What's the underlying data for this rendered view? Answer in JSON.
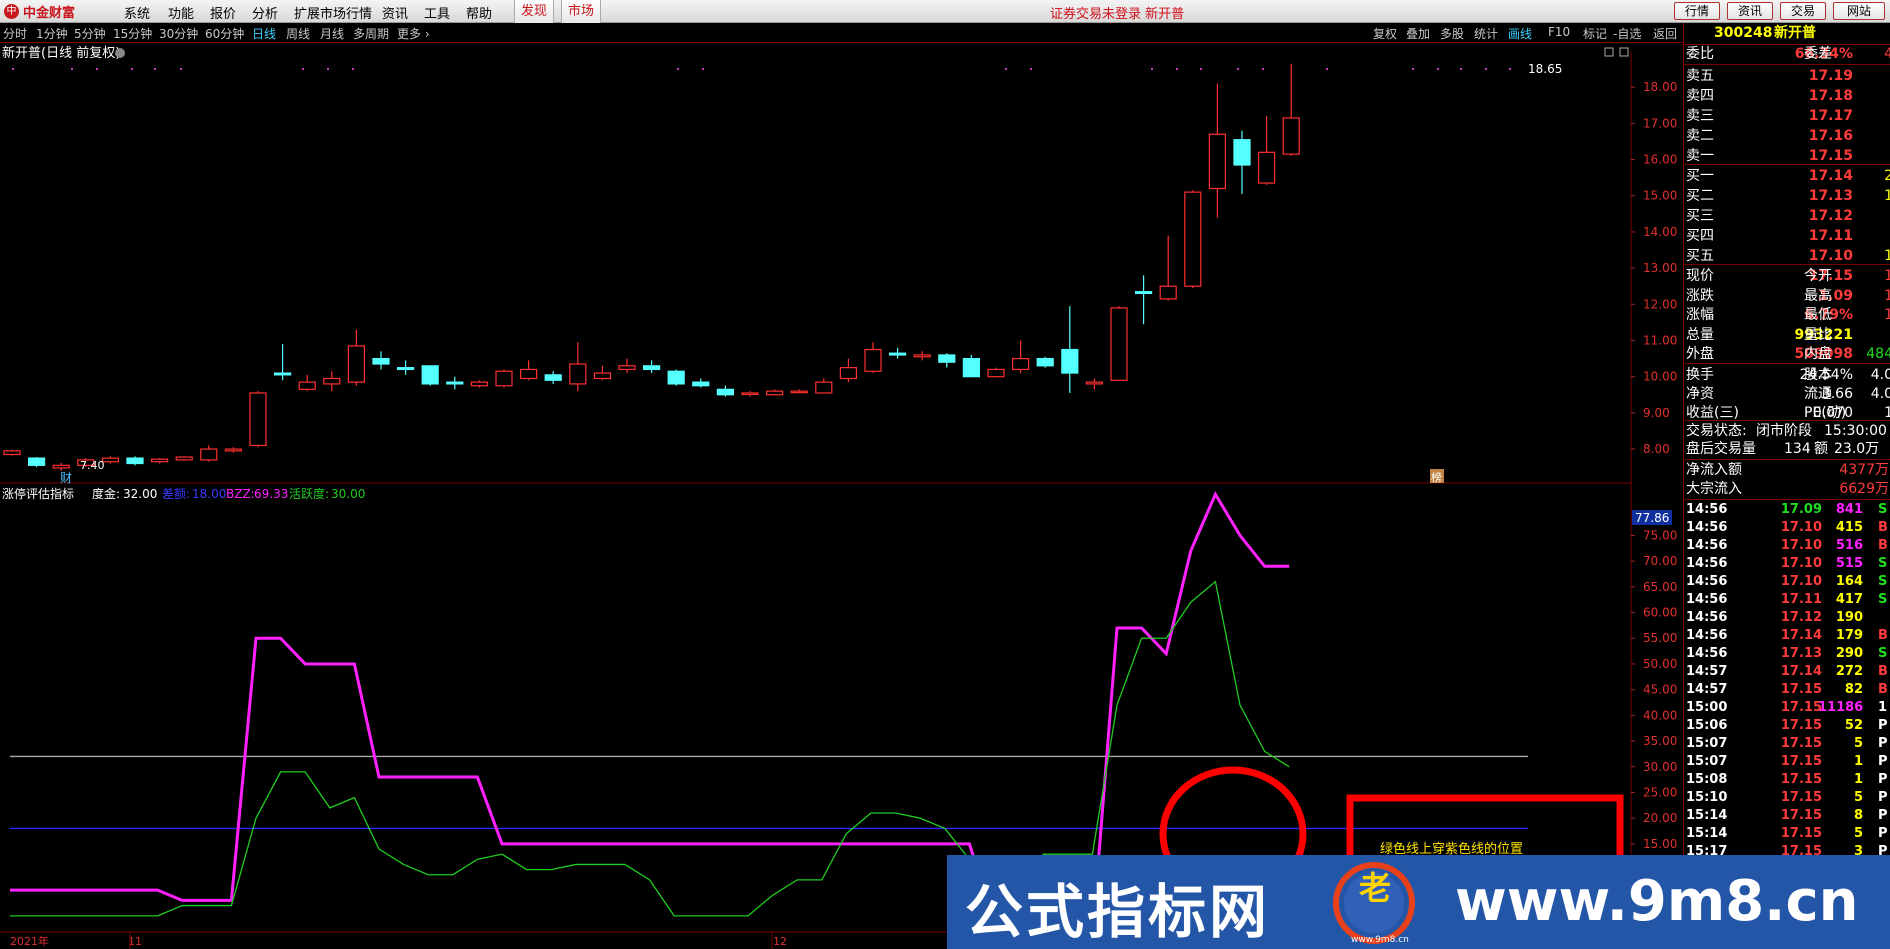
{
  "app": {
    "brand": "中金财富",
    "brand_mark": "中"
  },
  "menubar": {
    "items": [
      "系统",
      "功能",
      "报价",
      "分析",
      "扩展市场行情",
      "资讯",
      "工具",
      "帮助"
    ],
    "highlight": [
      "发现",
      "市场"
    ],
    "notice": "证券交易未登录  新开普",
    "right_buttons": [
      "行情",
      "资讯",
      "交易",
      "网站"
    ]
  },
  "periods": [
    "分时",
    "1分钟",
    "5分钟",
    "15分钟",
    "30分钟",
    "60分钟",
    "日线",
    "周线",
    "月线",
    "多周期",
    "更多 ›"
  ],
  "active_period": "日线",
  "toolbar_right": [
    "复权",
    "叠加",
    "多股",
    "统计",
    "画线",
    "F10",
    "标记",
    "-自选",
    "返回"
  ],
  "active_tool": "画线",
  "main_chart": {
    "title": "新开普(日线 前复权)",
    "high_label": "18.65",
    "low_label": "7.40",
    "fin_marker": "财",
    "event_marker": "榜",
    "y_ticks": [
      "18.00",
      "17.00",
      "16.00",
      "15.00",
      "14.00",
      "13.00",
      "12.00",
      "11.00",
      "10.00",
      "9.00",
      "8.00"
    ]
  },
  "chart_data": [
    {
      "type": "candlestick",
      "title": "新开普(日线 前复权)",
      "ylim": [
        7.2,
        19.0
      ],
      "candles": [
        {
          "o": 7.85,
          "c": 7.95,
          "h": 7.98,
          "l": 7.82
        },
        {
          "o": 7.75,
          "c": 7.55,
          "h": 7.78,
          "l": 7.5
        },
        {
          "o": 7.48,
          "c": 7.55,
          "h": 7.62,
          "l": 7.4
        },
        {
          "o": 7.55,
          "c": 7.7,
          "h": 7.75,
          "l": 7.5
        },
        {
          "o": 7.65,
          "c": 7.75,
          "h": 7.8,
          "l": 7.6
        },
        {
          "o": 7.75,
          "c": 7.6,
          "h": 7.8,
          "l": 7.55
        },
        {
          "o": 7.65,
          "c": 7.72,
          "h": 7.75,
          "l": 7.6
        },
        {
          "o": 7.7,
          "c": 7.78,
          "h": 7.8,
          "l": 7.68
        },
        {
          "o": 7.7,
          "c": 8.0,
          "h": 8.1,
          "l": 7.65
        },
        {
          "o": 7.95,
          "c": 8.0,
          "h": 8.05,
          "l": 7.9
        },
        {
          "o": 8.1,
          "c": 9.55,
          "h": 9.6,
          "l": 8.05
        },
        {
          "o": 10.1,
          "c": 10.05,
          "h": 10.9,
          "l": 9.9
        },
        {
          "o": 9.65,
          "c": 9.85,
          "h": 10.05,
          "l": 9.6
        },
        {
          "o": 9.8,
          "c": 9.95,
          "h": 10.15,
          "l": 9.6
        },
        {
          "o": 9.85,
          "c": 10.85,
          "h": 11.3,
          "l": 9.75
        },
        {
          "o": 10.5,
          "c": 10.35,
          "h": 10.7,
          "l": 10.2
        },
        {
          "o": 10.25,
          "c": 10.2,
          "h": 10.45,
          "l": 10.05
        },
        {
          "o": 10.3,
          "c": 9.8,
          "h": 10.3,
          "l": 9.75
        },
        {
          "o": 9.85,
          "c": 9.8,
          "h": 10.0,
          "l": 9.65
        },
        {
          "o": 9.75,
          "c": 9.85,
          "h": 9.9,
          "l": 9.7
        },
        {
          "o": 9.75,
          "c": 10.15,
          "h": 10.2,
          "l": 9.7
        },
        {
          "o": 9.95,
          "c": 10.2,
          "h": 10.45,
          "l": 9.9
        },
        {
          "o": 10.05,
          "c": 9.9,
          "h": 10.15,
          "l": 9.8
        },
        {
          "o": 9.8,
          "c": 10.35,
          "h": 10.95,
          "l": 9.6
        },
        {
          "o": 9.95,
          "c": 10.1,
          "h": 10.3,
          "l": 9.9
        },
        {
          "o": 10.2,
          "c": 10.3,
          "h": 10.5,
          "l": 10.1
        },
        {
          "o": 10.3,
          "c": 10.2,
          "h": 10.45,
          "l": 10.1
        },
        {
          "o": 10.15,
          "c": 9.8,
          "h": 10.2,
          "l": 9.75
        },
        {
          "o": 9.85,
          "c": 9.75,
          "h": 9.95,
          "l": 9.7
        },
        {
          "o": 9.65,
          "c": 9.5,
          "h": 9.75,
          "l": 9.45
        },
        {
          "o": 9.55,
          "c": 9.55,
          "h": 9.6,
          "l": 9.45
        },
        {
          "o": 9.5,
          "c": 9.6,
          "h": 9.65,
          "l": 9.5
        },
        {
          "o": 9.6,
          "c": 9.6,
          "h": 9.65,
          "l": 9.55
        },
        {
          "o": 9.55,
          "c": 9.85,
          "h": 9.95,
          "l": 9.55
        },
        {
          "o": 9.95,
          "c": 10.25,
          "h": 10.5,
          "l": 9.85
        },
        {
          "o": 10.15,
          "c": 10.75,
          "h": 10.95,
          "l": 10.1
        },
        {
          "o": 10.65,
          "c": 10.6,
          "h": 10.8,
          "l": 10.5
        },
        {
          "o": 10.55,
          "c": 10.6,
          "h": 10.7,
          "l": 10.45
        },
        {
          "o": 10.6,
          "c": 10.4,
          "h": 10.65,
          "l": 10.25
        },
        {
          "o": 10.5,
          "c": 10.0,
          "h": 10.6,
          "l": 10.0
        },
        {
          "o": 10.0,
          "c": 10.2,
          "h": 10.25,
          "l": 10.0
        },
        {
          "o": 10.2,
          "c": 10.5,
          "h": 11.0,
          "l": 10.1
        },
        {
          "o": 10.5,
          "c": 10.3,
          "h": 10.55,
          "l": 10.25
        },
        {
          "o": 10.75,
          "c": 10.1,
          "h": 11.95,
          "l": 9.55
        },
        {
          "o": 9.8,
          "c": 9.85,
          "h": 9.95,
          "l": 9.65
        },
        {
          "o": 9.9,
          "c": 11.9,
          "h": 11.95,
          "l": 9.9
        },
        {
          "o": 12.35,
          "c": 12.3,
          "h": 12.8,
          "l": 11.45
        },
        {
          "o": 12.15,
          "c": 12.5,
          "h": 13.9,
          "l": 12.1
        },
        {
          "o": 12.5,
          "c": 15.1,
          "h": 15.15,
          "l": 12.45
        },
        {
          "o": 15.2,
          "c": 16.7,
          "h": 18.1,
          "l": 14.4
        },
        {
          "o": 16.55,
          "c": 15.85,
          "h": 16.8,
          "l": 15.05
        },
        {
          "o": 15.35,
          "c": 16.2,
          "h": 17.2,
          "l": 15.3
        },
        {
          "o": 16.15,
          "c": 17.15,
          "h": 18.65,
          "l": 16.1
        }
      ]
    },
    {
      "type": "line",
      "title": "涨停评估指标",
      "ylim": [
        0,
        85
      ],
      "series": [
        {
          "name": "BZZ",
          "color": "#ff22ff",
          "values": [
            6,
            6,
            6,
            6,
            6,
            6,
            6,
            4,
            4,
            4,
            55,
            55,
            50,
            50,
            50,
            28,
            28,
            28,
            28,
            28,
            15,
            15,
            15,
            15,
            15,
            15,
            15,
            15,
            15,
            15,
            15,
            15,
            15,
            15,
            15,
            15,
            15,
            15,
            15,
            15,
            0,
            -3,
            -3,
            -3,
            -3,
            57,
            57,
            52,
            72,
            83,
            75,
            69,
            69
          ]
        },
        {
          "name": "活跃度",
          "color": "#22cc22",
          "values": [
            1,
            1,
            1,
            1,
            1,
            1,
            1,
            3,
            3,
            3,
            20,
            29,
            29,
            22,
            24,
            14,
            11,
            9,
            9,
            12,
            13,
            10,
            10,
            11,
            11,
            11,
            8,
            1,
            1,
            1,
            1,
            5,
            8,
            8,
            17,
            21,
            21,
            20,
            18,
            12,
            2,
            2,
            13,
            13,
            13,
            42,
            55,
            55,
            62,
            66,
            42,
            33,
            30
          ]
        }
      ],
      "hlines": [
        {
          "value": 32.0,
          "color": "#aaaaaa"
        },
        {
          "value": 18.0,
          "color": "#2a2aff"
        }
      ],
      "y_ticks": [
        "75.00",
        "70.00",
        "65.00",
        "60.00",
        "55.00",
        "50.00",
        "45.00",
        "40.00",
        "35.00",
        "30.00",
        "25.00",
        "20.00",
        "15.00"
      ]
    }
  ],
  "indicator": {
    "name": "涨停评估指标",
    "dujin_label": "度金:",
    "dujin_value": "32.00",
    "bl_label": "差额:",
    "bl_value": "18.00",
    "bzz_label": "BZZ:",
    "bzz_value": "69.33",
    "act_label": "活跃度:",
    "act_value": "30.00",
    "cursor_value": "77.86"
  },
  "x_axis": {
    "labels": [
      "2021年",
      "11",
      "12"
    ]
  },
  "annotation": "绿色线上穿紫色线的位置",
  "watermark": {
    "left": "公式指标网",
    "right": "www.9m8.cn",
    "emblem": "老",
    "emblem_sub": "www.9m8.cn"
  },
  "panel": {
    "code": "300248",
    "name": "新开普",
    "weibi_label": "委比",
    "weibi_value": "66.34%",
    "weicha_label": "委差",
    "weicha_value": "4",
    "asks": [
      {
        "label": "卖五",
        "price": "17.19",
        "vol": ""
      },
      {
        "label": "卖四",
        "price": "17.18",
        "vol": ""
      },
      {
        "label": "卖三",
        "price": "17.17",
        "vol": ""
      },
      {
        "label": "卖二",
        "price": "17.16",
        "vol": ""
      },
      {
        "label": "卖一",
        "price": "17.15",
        "vol": ""
      }
    ],
    "bids": [
      {
        "label": "买一",
        "price": "17.14",
        "vol": "2"
      },
      {
        "label": "买二",
        "price": "17.13",
        "vol": "1"
      },
      {
        "label": "买三",
        "price": "17.12",
        "vol": ""
      },
      {
        "label": "买四",
        "price": "17.11",
        "vol": ""
      },
      {
        "label": "买五",
        "price": "17.10",
        "vol": "1"
      }
    ],
    "stats": [
      {
        "l1": "现价",
        "v1": "17.15",
        "c1": "red",
        "l2": "今开",
        "v2": "1",
        "c2": "red"
      },
      {
        "l1": "涨跌",
        "v1": "1.09",
        "c1": "red",
        "l2": "最高",
        "v2": "1",
        "c2": "red"
      },
      {
        "l1": "涨幅",
        "v1": "6.79%",
        "c1": "red",
        "l2": "最低",
        "v2": "1",
        "c2": "red"
      },
      {
        "l1": "总量",
        "v1": "993221",
        "c1": "yellow",
        "l2": "量比",
        "v2": "",
        "c2": "white"
      },
      {
        "l1": "外盘",
        "v1": "509098",
        "c1": "red",
        "l2": "内盘",
        "v2": "484",
        "c2": "green"
      }
    ],
    "stats2": [
      {
        "l1": "换手",
        "v1": "24.54%",
        "c1": "white",
        "l2": "股本",
        "v2": "4.0",
        "c2": "white"
      },
      {
        "l1": "净资",
        "v1": "3.66",
        "c1": "white",
        "l2": "流通",
        "v2": "4.0",
        "c2": "white"
      },
      {
        "l1": "收益(三)",
        "v1": "0.070",
        "c1": "white",
        "l2": "PE(动)",
        "v2": "1",
        "c2": "white"
      }
    ],
    "status_label": "交易状态:",
    "status_value": "闭市阶段",
    "status_time": "15:30:00",
    "after_label": "盘后交易量",
    "after_vol": "134",
    "after_amt_label": "额",
    "after_amt": "23.0万",
    "flow": [
      {
        "label": "净流入额",
        "value": "4377万"
      },
      {
        "label": "大宗流入",
        "value": "6629万"
      }
    ],
    "ticks": [
      {
        "t": "14:56",
        "p": "17.09",
        "pc": "green",
        "v": "841",
        "vc": "magenta",
        "bs": "S"
      },
      {
        "t": "14:56",
        "p": "17.10",
        "pc": "red",
        "v": "415",
        "vc": "yellow",
        "bs": "B"
      },
      {
        "t": "14:56",
        "p": "17.10",
        "pc": "red",
        "v": "516",
        "vc": "magenta",
        "bs": "B"
      },
      {
        "t": "14:56",
        "p": "17.10",
        "pc": "red",
        "v": "515",
        "vc": "magenta",
        "bs": "S"
      },
      {
        "t": "14:56",
        "p": "17.10",
        "pc": "red",
        "v": "164",
        "vc": "yellow",
        "bs": "S"
      },
      {
        "t": "14:56",
        "p": "17.11",
        "pc": "red",
        "v": "417",
        "vc": "yellow",
        "bs": "S"
      },
      {
        "t": "14:56",
        "p": "17.12",
        "pc": "red",
        "v": "190",
        "vc": "yellow",
        "bs": ""
      },
      {
        "t": "14:56",
        "p": "17.14",
        "pc": "red",
        "v": "179",
        "vc": "yellow",
        "bs": "B"
      },
      {
        "t": "14:56",
        "p": "17.13",
        "pc": "red",
        "v": "290",
        "vc": "yellow",
        "bs": "S"
      },
      {
        "t": "14:57",
        "p": "17.14",
        "pc": "red",
        "v": "272",
        "vc": "yellow",
        "bs": "B"
      },
      {
        "t": "14:57",
        "p": "17.15",
        "pc": "red",
        "v": "82",
        "vc": "yellow",
        "bs": "B"
      },
      {
        "t": "15:00",
        "p": "17.15",
        "pc": "red",
        "v": "11186",
        "vc": "magenta",
        "bs": "1"
      },
      {
        "t": "15:06",
        "p": "17.15",
        "pc": "red",
        "v": "52",
        "vc": "yellow",
        "bs": "P"
      },
      {
        "t": "15:07",
        "p": "17.15",
        "pc": "red",
        "v": "5",
        "vc": "yellow",
        "bs": "P"
      },
      {
        "t": "15:07",
        "p": "17.15",
        "pc": "red",
        "v": "1",
        "vc": "yellow",
        "bs": "P"
      },
      {
        "t": "15:08",
        "p": "17.15",
        "pc": "red",
        "v": "1",
        "vc": "yellow",
        "bs": "P"
      },
      {
        "t": "15:10",
        "p": "17.15",
        "pc": "red",
        "v": "5",
        "vc": "yellow",
        "bs": "P"
      },
      {
        "t": "15:14",
        "p": "17.15",
        "pc": "red",
        "v": "8",
        "vc": "yellow",
        "bs": "P"
      },
      {
        "t": "15:14",
        "p": "17.15",
        "pc": "red",
        "v": "5",
        "vc": "yellow",
        "bs": "P"
      },
      {
        "t": "15:17",
        "p": "17.15",
        "pc": "red",
        "v": "3",
        "vc": "yellow",
        "bs": "P"
      }
    ]
  },
  "colors": {
    "up": "#ff3030",
    "down": "#54ffff",
    "bzz": "#ff22ff",
    "active": "#22cc22",
    "accent": "#c8161d"
  }
}
